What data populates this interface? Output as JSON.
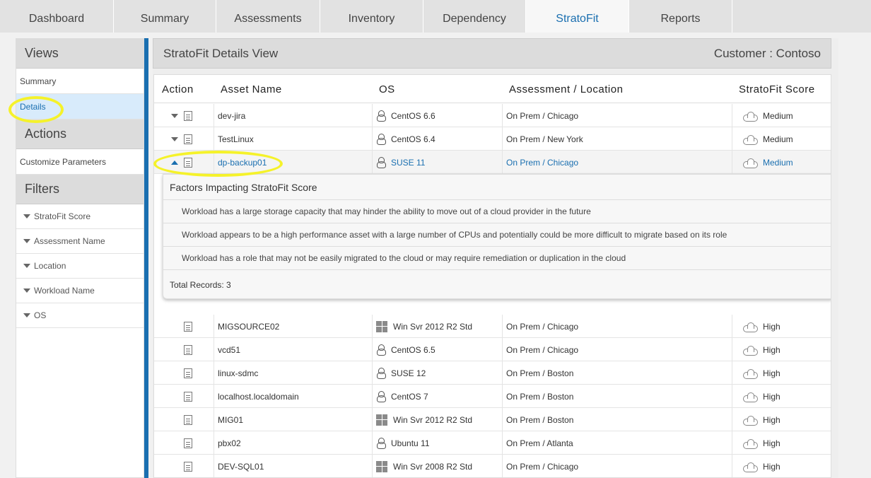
{
  "nav": {
    "tabs": [
      {
        "label": "Dashboard"
      },
      {
        "label": "Summary"
      },
      {
        "label": "Assessments"
      },
      {
        "label": "Inventory"
      },
      {
        "label": "Dependency"
      },
      {
        "label": "StratoFit"
      },
      {
        "label": "Reports"
      }
    ]
  },
  "sidebar": {
    "views_title": "Views",
    "views": [
      {
        "label": "Summary"
      },
      {
        "label": "Details"
      }
    ],
    "actions_title": "Actions",
    "actions": [
      {
        "label": "Customize Parameters"
      }
    ],
    "filters_title": "Filters",
    "filters": [
      {
        "label": "StratoFit Score"
      },
      {
        "label": "Assessment Name"
      },
      {
        "label": "Location"
      },
      {
        "label": "Workload Name"
      },
      {
        "label": "OS"
      }
    ]
  },
  "main": {
    "title": "StratoFit Details View",
    "customer": "Customer : Contoso",
    "columns": {
      "action": "Action",
      "asset": "Asset Name",
      "os": "OS",
      "location": "Assessment / Location",
      "score": "StratoFit Score"
    },
    "rows_top": [
      {
        "asset": "dev-jira",
        "os": "CentOS 6.6",
        "os_icon": "linux-icon",
        "location": "On Prem / Chicago",
        "score": "Medium"
      },
      {
        "asset": "TestLinux",
        "os": "CentOS 6.4",
        "os_icon": "linux-icon",
        "location": "On Prem / New York",
        "score": "Medium"
      },
      {
        "asset": "dp-backup01",
        "os": "SUSE 11",
        "os_icon": "linux-icon",
        "location": "On Prem / Chicago",
        "score": "Medium"
      }
    ],
    "factors": {
      "title": "Factors Impacting StratoFit Score",
      "items": [
        "Workload has a large storage capacity that may hinder the ability to move out of a cloud provider in the future",
        "Workload appears to be a high performance asset with a large number of CPUs and potentially could be more difficult to migrate based on its role",
        "Workload has a role that may not be easily migrated to the cloud or may require remediation or duplication in the cloud"
      ],
      "total": "Total Records: 3"
    },
    "rows_bottom": [
      {
        "asset": "MIGSOURCE02",
        "os": "Win Svr 2012 R2 Std",
        "os_icon": "windows-icon",
        "location": "On Prem / Chicago",
        "score": "High"
      },
      {
        "asset": "vcd51",
        "os": "CentOS 6.5",
        "os_icon": "linux-icon",
        "location": "On Prem / Chicago",
        "score": "High"
      },
      {
        "asset": "linux-sdmc",
        "os": "SUSE 12",
        "os_icon": "linux-icon",
        "location": "On Prem / Boston",
        "score": "High"
      },
      {
        "asset": "localhost.localdomain",
        "os": "CentOS 7",
        "os_icon": "linux-icon",
        "location": "On Prem / Boston",
        "score": "High"
      },
      {
        "asset": "MIG01",
        "os": "Win Svr 2012 R2 Std",
        "os_icon": "windows-icon",
        "location": "On Prem / Boston",
        "score": "High"
      },
      {
        "asset": "pbx02",
        "os": "Ubuntu 11",
        "os_icon": "linux-icon",
        "location": "On Prem / Atlanta",
        "score": "High"
      },
      {
        "asset": "DEV-SQL01",
        "os": "Win Svr 2008 R2 Std",
        "os_icon": "windows-icon",
        "location": "On Prem / Chicago",
        "score": "High"
      }
    ]
  },
  "colors": {
    "accent": "#1a6fb0",
    "highlight": "#f5f22a",
    "selected_bg": "#d8ebfb"
  }
}
